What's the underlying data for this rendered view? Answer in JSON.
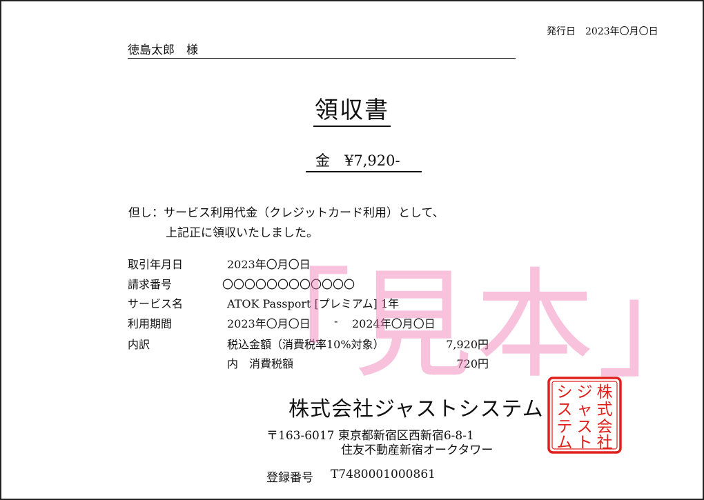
{
  "receipt": {
    "issue_date": "発行日　2023年〇月〇日",
    "recipient": "徳島太郎　様",
    "title": "領収書",
    "amount": "金　¥7,920-",
    "note_line1": "但し：サービス利用代金（クレジットカード利用）として、",
    "note_line2": "上記正に領収いたしました。",
    "details": {
      "transaction_date_label": "取引年月日",
      "transaction_date_value": "2023年〇月〇日",
      "invoice_number_label": "請求番号",
      "invoice_number_value": "〇〇〇〇〇〇〇〇〇〇〇〇",
      "service_name_label": "サービス名",
      "service_name_value": "ATOK Passport [プレミアム] 1年",
      "period_label": "利用期間",
      "period_start": "2023年〇月〇日",
      "period_dash": "-",
      "period_end": "2024年〇月〇日",
      "breakdown_label": "内訳",
      "tax_included_label": "税込金額（消費税率10%対象）",
      "tax_included_value": "7,920円",
      "consumption_tax_label": "内　消費税額",
      "consumption_tax_value": "720円"
    },
    "issuer": {
      "company_name": "株式会社ジャストシステム",
      "address_line1": "〒163-6017 東京都新宿区西新宿6-8-1",
      "address_line2": "住友不動産新宿オークタワー",
      "registration_label": "登録番号",
      "registration_value": "T7480001000861"
    },
    "watermark": "「見本」",
    "seal": {
      "text_columns": [
        "株式会社",
        "ジャスト",
        "システム"
      ],
      "color": "#e0201c"
    }
  }
}
